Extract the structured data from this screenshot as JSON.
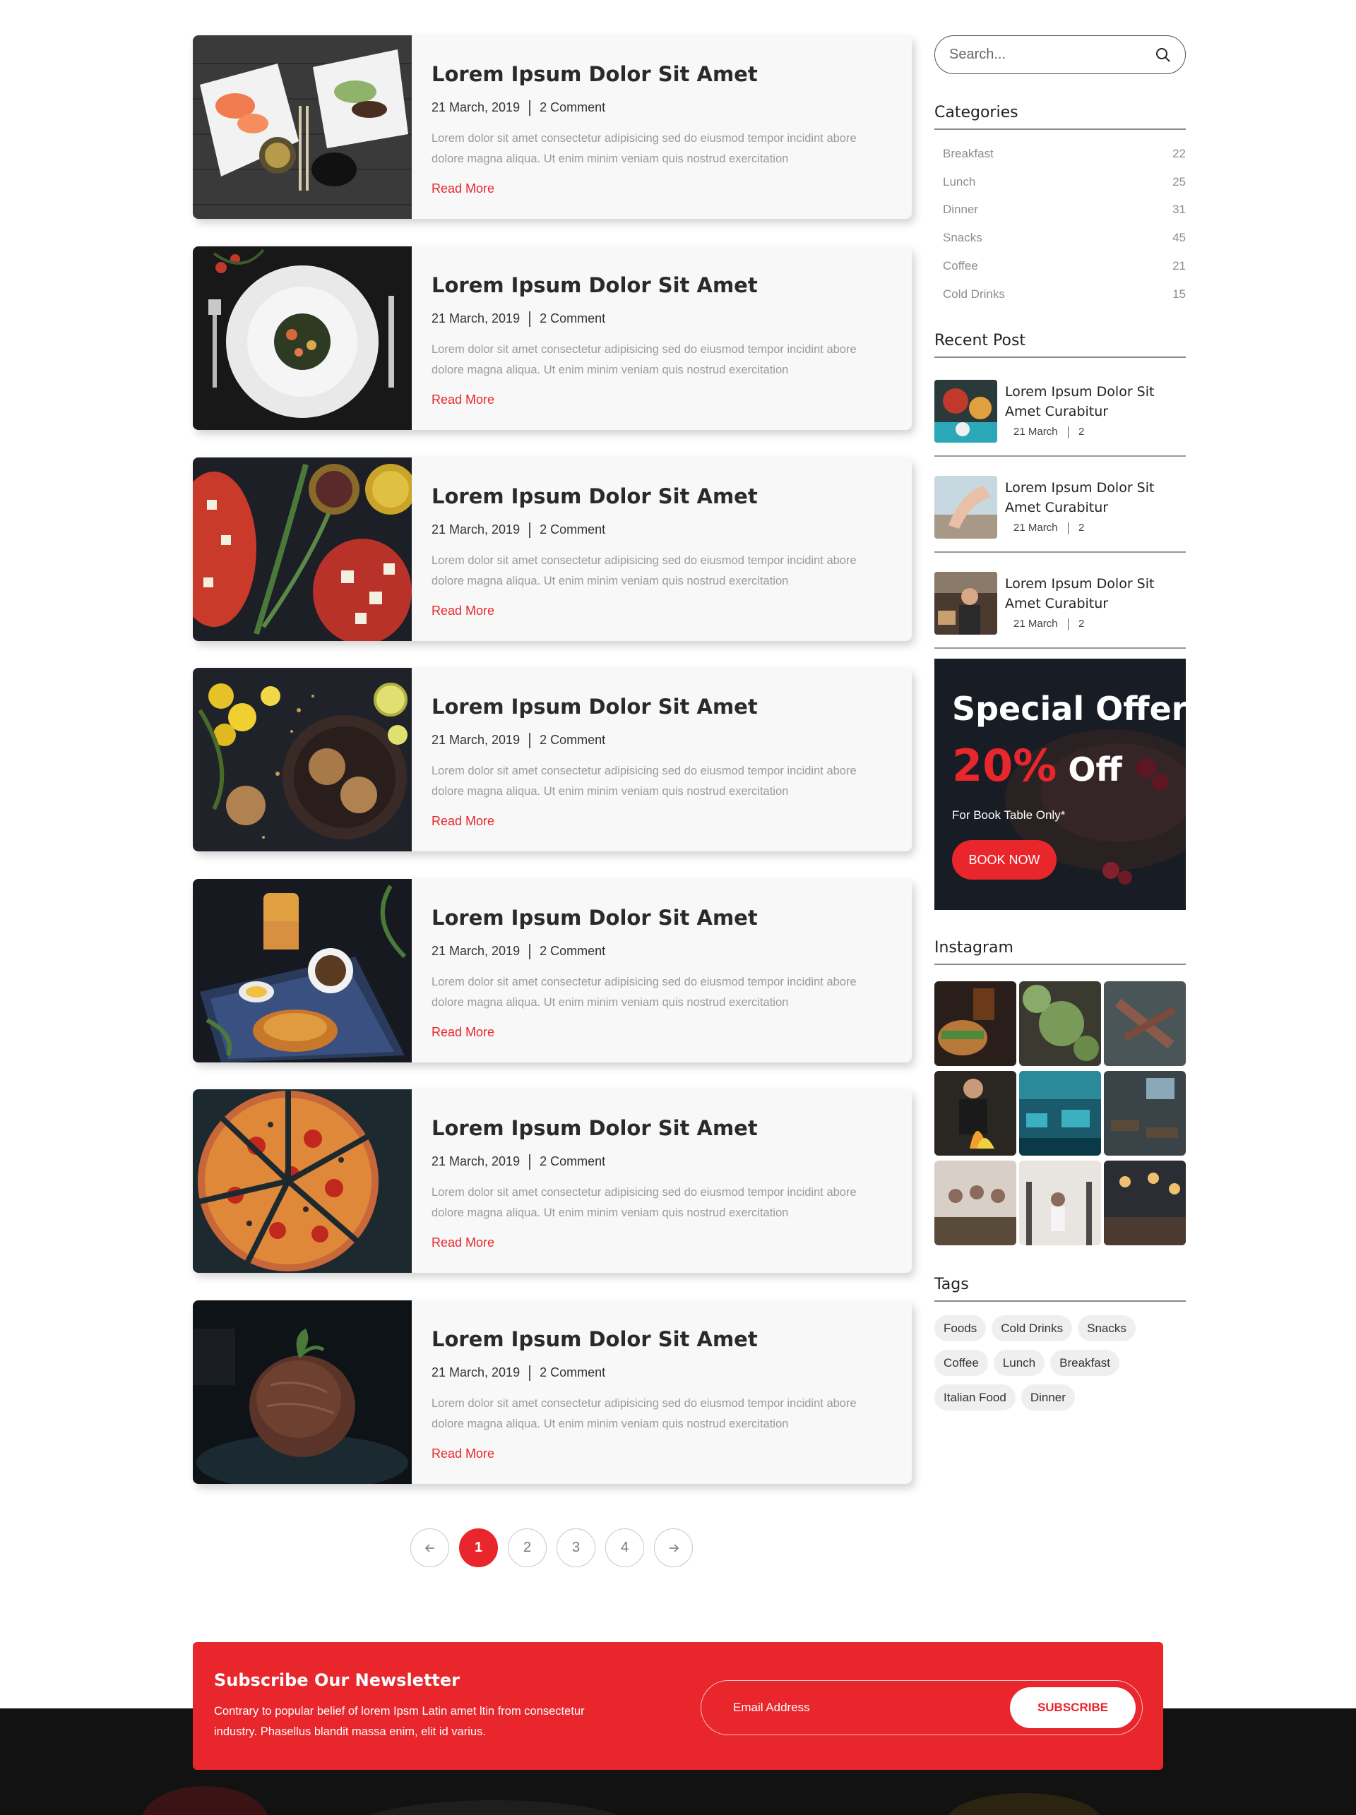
{
  "posts": [
    {
      "title": "Lorem Ipsum Dolor Sit Amet",
      "date": "21 March, 2019",
      "comments": "2 Comment",
      "excerpt": "Lorem dolor sit amet consectetur adipisicing sed do eiusmod tempor incidint abore dolore magna aliqua. Ut enim minim veniam quis nostrud exercitation",
      "read_more": "Read More",
      "image": "sushi-platter-image"
    },
    {
      "title": "Lorem Ipsum Dolor Sit Amet",
      "date": "21 March, 2019",
      "comments": "2 Comment",
      "excerpt": "Lorem dolor sit amet consectetur adipisicing sed do eiusmod tempor incidint abore dolore magna aliqua. Ut enim minim veniam quis nostrud exercitation",
      "read_more": "Read More",
      "image": "pasta-plate-image"
    },
    {
      "title": "Lorem Ipsum Dolor Sit Amet",
      "date": "21 March, 2019",
      "comments": "2 Comment",
      "excerpt": "Lorem dolor sit amet consectetur adipisicing sed do eiusmod tempor incidint abore dolore magna aliqua. Ut enim minim veniam quis nostrud exercitation",
      "read_more": "Read More",
      "image": "bruschetta-image"
    },
    {
      "title": "Lorem Ipsum Dolor Sit Amet",
      "date": "21 March, 2019",
      "comments": "2 Comment",
      "excerpt": "Lorem dolor sit amet consectetur adipisicing sed do eiusmod tempor incidint abore dolore magna aliqua. Ut enim minim veniam quis nostrud exercitation",
      "read_more": "Read More",
      "image": "cookies-image"
    },
    {
      "title": "Lorem Ipsum Dolor Sit Amet",
      "date": "21 March, 2019",
      "comments": "2 Comment",
      "excerpt": "Lorem dolor sit amet consectetur adipisicing sed do eiusmod tempor incidint abore dolore magna aliqua. Ut enim minim veniam quis nostrud exercitation",
      "read_more": "Read More",
      "image": "croissant-breakfast-image"
    },
    {
      "title": "Lorem Ipsum Dolor Sit Amet",
      "date": "21 March, 2019",
      "comments": "2 Comment",
      "excerpt": "Lorem dolor sit amet consectetur adipisicing sed do eiusmod tempor incidint abore dolore magna aliqua. Ut enim minim veniam quis nostrud exercitation",
      "read_more": "Read More",
      "image": "pizza-image"
    },
    {
      "title": "Lorem Ipsum Dolor Sit Amet",
      "date": "21 March, 2019",
      "comments": "2 Comment",
      "excerpt": "Lorem dolor sit amet consectetur adipisicing sed do eiusmod tempor incidint abore dolore magna aliqua. Ut enim minim veniam quis nostrud exercitation",
      "read_more": "Read More",
      "image": "dessert-image"
    }
  ],
  "pagination": {
    "prev_icon": "arrow-left-icon",
    "pages": [
      "1",
      "2",
      "3",
      "4"
    ],
    "active": "1",
    "next_icon": "arrow-right-icon"
  },
  "sidebar": {
    "search": {
      "placeholder": "Search...",
      "icon": "search-icon"
    },
    "categories": {
      "title": "Categories",
      "items": [
        {
          "label": "Breakfast",
          "count": "22"
        },
        {
          "label": "Lunch",
          "count": "25"
        },
        {
          "label": "Dinner",
          "count": "31"
        },
        {
          "label": "Snacks",
          "count": "45"
        },
        {
          "label": "Coffee",
          "count": "21"
        },
        {
          "label": "Cold Drinks",
          "count": "15"
        }
      ]
    },
    "recent": {
      "title": "Recent Post",
      "items": [
        {
          "title": "Lorem Ipsum Dolor Sit Amet Curabitur",
          "date": "21 March",
          "comments": "2"
        },
        {
          "title": "Lorem Ipsum Dolor Sit Amet Curabitur",
          "date": "21 March",
          "comments": "2"
        },
        {
          "title": "Lorem Ipsum Dolor Sit Amet Curabitur",
          "date": "21 March",
          "comments": "2"
        }
      ]
    },
    "offer": {
      "line1": "Special Offer",
      "percent": "20%",
      "off": "Off",
      "note": "For Book Table Only*",
      "button": "BOOK NOW"
    },
    "instagram": {
      "title": "Instagram"
    },
    "tags": {
      "title": "Tags",
      "items": [
        "Foods",
        "Cold Drinks",
        "Snacks",
        "Coffee",
        "Lunch",
        "Breakfast",
        "Italian Food",
        "Dinner"
      ]
    }
  },
  "newsletter": {
    "title": "Subscribe Our Newsletter",
    "text": "Contrary to popular belief of lorem Ipsm Latin amet ltin from consectetur industry. Phasellus blandit massa enim, elit id varius.",
    "placeholder": "Email Address",
    "button": "SUBSCRIBE"
  },
  "colors": {
    "accent": "#e8262c",
    "card_bg": "#f8f8f8",
    "muted_text": "#9a9a9a"
  }
}
